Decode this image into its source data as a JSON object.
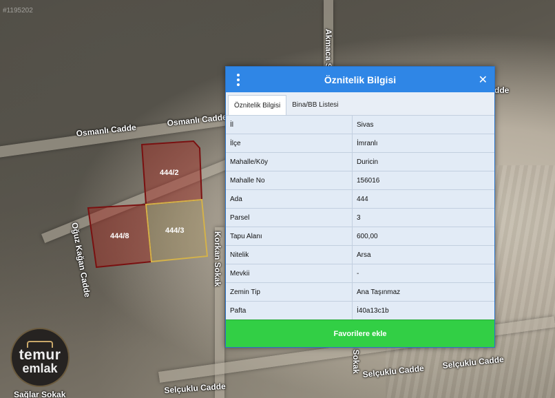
{
  "watermark_id": "#1195202",
  "map": {
    "roads": {
      "osmanli_1": "Osmanlı Cadde",
      "osmanli_2": "Osmanlı Cadde",
      "akmaca": "Akmaca Sok",
      "oguz_kagan": "Oğuz Kağan Cadde",
      "korkan": "Korkan Sokak",
      "selcuklu_1": "Selçuklu Cadde",
      "selcuklu_2": "Selçuklu Cadde",
      "selcuklu_3": "Selçuklu Cadde",
      "cadde_right": "dde",
      "sokak_right": "an Sokak",
      "bottom_left": "Sağlar Sokak"
    },
    "parcels": [
      {
        "label": "444/2",
        "color": "#c0392b"
      },
      {
        "label": "444/8",
        "color": "#c0392b"
      },
      {
        "label": "444/3",
        "color": "#d4b24a"
      }
    ]
  },
  "logo": {
    "line1": "temur",
    "line2": "emlak"
  },
  "dialog": {
    "title": "Öznitelik Bilgisi",
    "tabs": [
      "Öznitelik Bilgisi",
      "Bina/BB Listesi"
    ],
    "rows": [
      {
        "key": "İl",
        "value": "Sivas"
      },
      {
        "key": "İlçe",
        "value": "İmranlı"
      },
      {
        "key": "Mahalle/Köy",
        "value": "Duricin"
      },
      {
        "key": "Mahalle No",
        "value": "156016"
      },
      {
        "key": "Ada",
        "value": "444"
      },
      {
        "key": "Parsel",
        "value": "3"
      },
      {
        "key": "Tapu Alanı",
        "value": "600,00"
      },
      {
        "key": "Nitelik",
        "value": "Arsa"
      },
      {
        "key": "Mevkii",
        "value": "-"
      },
      {
        "key": "Zemin Tip",
        "value": "Ana Taşınmaz"
      },
      {
        "key": "Pafta",
        "value": "İ40a13c1b"
      }
    ],
    "favorite_button": "Favorilere ekle"
  }
}
